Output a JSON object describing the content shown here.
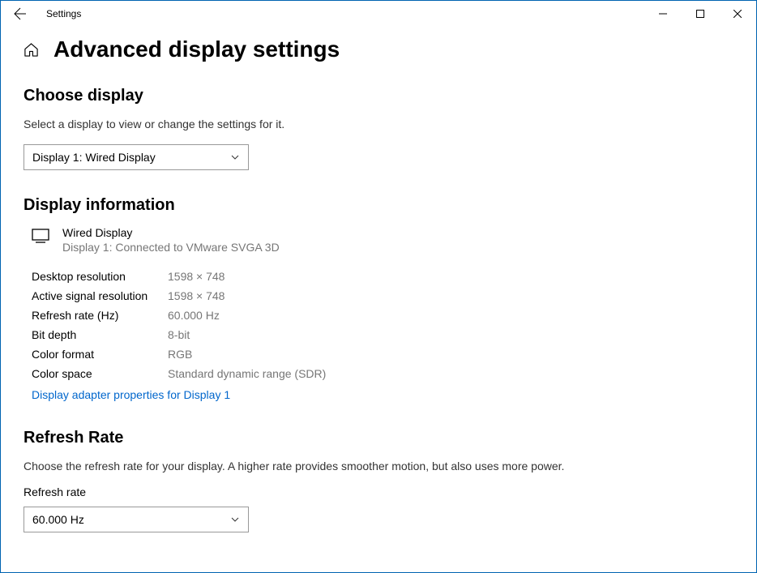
{
  "titlebar": {
    "title": "Settings"
  },
  "page": {
    "title": "Advanced display settings"
  },
  "choose_display": {
    "heading": "Choose display",
    "description": "Select a display to view or change the settings for it.",
    "selected": "Display 1: Wired Display"
  },
  "display_info": {
    "heading": "Display information",
    "name": "Wired Display",
    "connection": "Display 1: Connected to VMware SVGA 3D",
    "specs": [
      {
        "label": "Desktop resolution",
        "value": "1598 × 748"
      },
      {
        "label": "Active signal resolution",
        "value": "1598 × 748"
      },
      {
        "label": "Refresh rate (Hz)",
        "value": "60.000 Hz"
      },
      {
        "label": "Bit depth",
        "value": "8-bit"
      },
      {
        "label": "Color format",
        "value": "RGB"
      },
      {
        "label": "Color space",
        "value": "Standard dynamic range (SDR)"
      }
    ],
    "adapter_link": "Display adapter properties for Display 1"
  },
  "refresh_rate": {
    "heading": "Refresh Rate",
    "description": "Choose the refresh rate for your display. A higher rate provides smoother motion, but also uses more power.",
    "label": "Refresh rate",
    "selected": "60.000 Hz"
  }
}
